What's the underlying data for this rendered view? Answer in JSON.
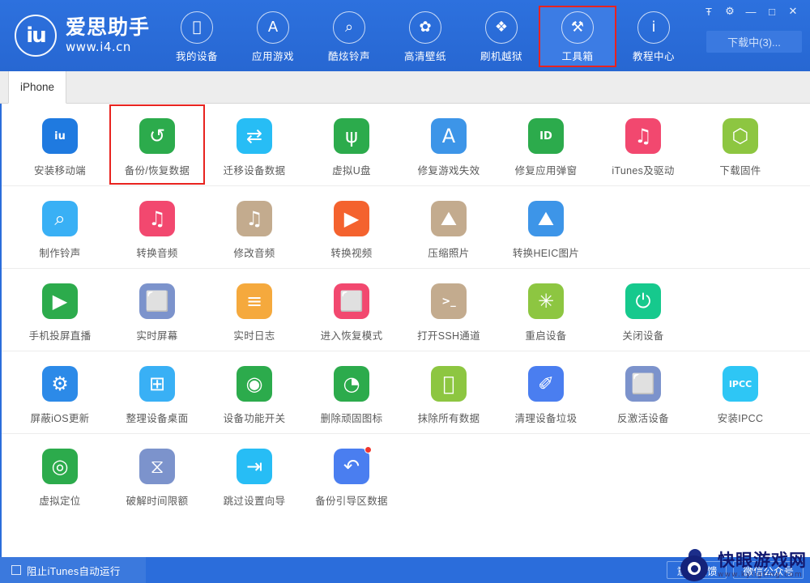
{
  "brand": {
    "name": "爱思助手",
    "url": "www.i4.cn",
    "mark": "iu"
  },
  "nav": [
    {
      "label": "我的设备",
      "icon": "apple-icon",
      "glyph": "",
      "active": false,
      "highlight": false
    },
    {
      "label": "应用游戏",
      "icon": "appstore-icon",
      "glyph": "A",
      "active": false,
      "highlight": false
    },
    {
      "label": "酷炫铃声",
      "icon": "bell-icon",
      "glyph": "⌕",
      "active": false,
      "highlight": false
    },
    {
      "label": "高清壁纸",
      "icon": "flower-icon",
      "glyph": "✿",
      "active": false,
      "highlight": false
    },
    {
      "label": "刷机越狱",
      "icon": "flash-box-icon",
      "glyph": "❖",
      "active": false,
      "highlight": false
    },
    {
      "label": "工具箱",
      "icon": "toolbox-icon",
      "glyph": "⚒",
      "active": true,
      "highlight": true
    },
    {
      "label": "教程中心",
      "icon": "info-icon",
      "glyph": "i",
      "active": false,
      "highlight": false
    }
  ],
  "window_controls": [
    {
      "name": "skin-icon",
      "glyph": "Ŧ"
    },
    {
      "name": "settings-gear-icon",
      "glyph": "⚙"
    },
    {
      "name": "minimize-icon",
      "glyph": "—"
    },
    {
      "name": "maximize-icon",
      "glyph": "□"
    },
    {
      "name": "close-icon",
      "glyph": "✕"
    }
  ],
  "download_button": {
    "label": "下载中(3)..."
  },
  "tab": {
    "label": "iPhone"
  },
  "sections": [
    {
      "name": "data-tools",
      "items": [
        {
          "label": "安装移动端",
          "icon": "i4-app-icon",
          "color": "#1f7ae0",
          "glyph": "iu",
          "selected": false,
          "badge": false
        },
        {
          "label": "备份/恢复数据",
          "icon": "backup-restore-icon",
          "color": "#2cab4c",
          "glyph": "↺",
          "selected": true,
          "badge": false
        },
        {
          "label": "迁移设备数据",
          "icon": "migrate-data-icon",
          "color": "#27bdf5",
          "glyph": "⇄",
          "selected": false,
          "badge": false
        },
        {
          "label": "虚拟U盘",
          "icon": "virtual-udisk-icon",
          "color": "#2cab4c",
          "glyph": "ψ",
          "selected": false,
          "badge": false
        },
        {
          "label": "修复游戏失效",
          "icon": "fix-game-icon",
          "color": "#3d95e8",
          "glyph": "A",
          "selected": false,
          "badge": false
        },
        {
          "label": "修复应用弹窗",
          "icon": "fix-appleid-popup-icon",
          "color": "#2cab4c",
          "glyph": "ID",
          "selected": false,
          "badge": false
        },
        {
          "label": "iTunes及驱动",
          "icon": "itunes-driver-icon",
          "color": "#f2486f",
          "glyph": "♫",
          "selected": false,
          "badge": false
        },
        {
          "label": "下载固件",
          "icon": "download-firmware-icon",
          "color": "#8dc641",
          "glyph": "⬡",
          "selected": false,
          "badge": false
        }
      ]
    },
    {
      "name": "media-tools",
      "items": [
        {
          "label": "制作铃声",
          "icon": "make-ringtone-icon",
          "color": "#39b0f5",
          "glyph": "⌕",
          "selected": false,
          "badge": false
        },
        {
          "label": "转换音频",
          "icon": "convert-audio-icon",
          "color": "#f2486f",
          "glyph": "♫",
          "selected": false,
          "badge": false
        },
        {
          "label": "修改音频",
          "icon": "edit-audio-icon",
          "color": "#c3ab8e",
          "glyph": "♫",
          "selected": false,
          "badge": false
        },
        {
          "label": "转换视频",
          "icon": "convert-video-icon",
          "color": "#f4622e",
          "glyph": "▶",
          "selected": false,
          "badge": false
        },
        {
          "label": "压缩照片",
          "icon": "compress-photo-icon",
          "color": "#c3ab8e",
          "glyph": "⛰",
          "selected": false,
          "badge": false
        },
        {
          "label": "转换HEIC图片",
          "icon": "convert-heic-icon",
          "color": "#3d95e8",
          "glyph": "⛰",
          "selected": false,
          "badge": false
        }
      ]
    },
    {
      "name": "screen-tools",
      "items": [
        {
          "label": "手机投屏直播",
          "icon": "screen-live-icon",
          "color": "#2cab4c",
          "glyph": "▶",
          "selected": false,
          "badge": false
        },
        {
          "label": "实时屏幕",
          "icon": "realtime-screen-icon",
          "color": "#7c93cc",
          "glyph": "⬜",
          "selected": false,
          "badge": false
        },
        {
          "label": "实时日志",
          "icon": "realtime-log-icon",
          "color": "#f5a93d",
          "glyph": "≡",
          "selected": false,
          "badge": false
        },
        {
          "label": "进入恢复模式",
          "icon": "recovery-mode-icon",
          "color": "#f2486f",
          "glyph": "⬜",
          "selected": false,
          "badge": false
        },
        {
          "label": "打开SSH通道",
          "icon": "ssh-tunnel-icon",
          "color": "#c3ab8e",
          "glyph": ">_",
          "selected": false,
          "badge": false
        },
        {
          "label": "重启设备",
          "icon": "reboot-device-icon",
          "color": "#8dc641",
          "glyph": "✳",
          "selected": false,
          "badge": false
        },
        {
          "label": "关闭设备",
          "icon": "shutdown-device-icon",
          "color": "#16c98d",
          "glyph": "⏻",
          "selected": false,
          "badge": false
        }
      ]
    },
    {
      "name": "system-tools",
      "items": [
        {
          "label": "屏蔽iOS更新",
          "icon": "block-ios-update-icon",
          "color": "#2c8ae8",
          "glyph": "⚙",
          "selected": false,
          "badge": false
        },
        {
          "label": "整理设备桌面",
          "icon": "arrange-desktop-icon",
          "color": "#39b0f5",
          "glyph": "⊞",
          "selected": false,
          "badge": false
        },
        {
          "label": "设备功能开关",
          "icon": "feature-switch-icon",
          "color": "#2cab4c",
          "glyph": "◉",
          "selected": false,
          "badge": false
        },
        {
          "label": "删除顽固图标",
          "icon": "remove-icon-icon",
          "color": "#2cab4c",
          "glyph": "◔",
          "selected": false,
          "badge": false
        },
        {
          "label": "抹除所有数据",
          "icon": "erase-all-data-icon",
          "color": "#8dc641",
          "glyph": "",
          "selected": false,
          "badge": false
        },
        {
          "label": "清理设备垃圾",
          "icon": "clean-junk-icon",
          "color": "#4a7ef0",
          "glyph": "✐",
          "selected": false,
          "badge": false
        },
        {
          "label": "反激活设备",
          "icon": "deactivate-device-icon",
          "color": "#7c93cc",
          "glyph": "⬜",
          "selected": false,
          "badge": false
        },
        {
          "label": "安装IPCC",
          "icon": "install-ipcc-icon",
          "color": "#2ec6f5",
          "glyph": "IPCC",
          "selected": false,
          "badge": false
        }
      ]
    },
    {
      "name": "advanced-tools",
      "items": [
        {
          "label": "虚拟定位",
          "icon": "virtual-location-icon",
          "color": "#2cab4c",
          "glyph": "◎",
          "selected": false,
          "badge": false
        },
        {
          "label": "破解时间限额",
          "icon": "crack-time-limit-icon",
          "color": "#7c93cc",
          "glyph": "⧖",
          "selected": false,
          "badge": false
        },
        {
          "label": "跳过设置向导",
          "icon": "skip-setup-icon",
          "color": "#27bdf5",
          "glyph": "⇥",
          "selected": false,
          "badge": false
        },
        {
          "label": "备份引导区数据",
          "icon": "backup-boot-data-icon",
          "color": "#4a7ef0",
          "glyph": "↶",
          "selected": false,
          "badge": true
        }
      ]
    }
  ],
  "footer": {
    "checkbox_label": "阻止iTunes自动运行",
    "buttons": [
      {
        "label": "意见反馈"
      },
      {
        "label": "微信公众号"
      }
    ]
  },
  "watermark": {
    "name": "快眼游戏网",
    "url": "www.kyiigting.com"
  }
}
